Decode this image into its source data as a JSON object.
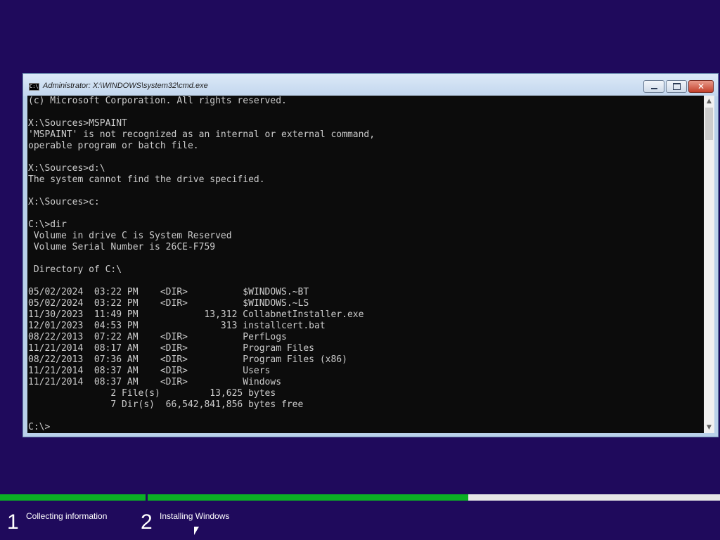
{
  "window": {
    "title": "Administrator: X:\\WINDOWS\\system32\\cmd.exe",
    "icon": "cmd-icon",
    "icon_text": "C:\\"
  },
  "console": {
    "lines": [
      "(c) Microsoft Corporation. All rights reserved.",
      "",
      "X:\\Sources>MSPAINT",
      "'MSPAINT' is not recognized as an internal or external command,",
      "operable program or batch file.",
      "",
      "X:\\Sources>d:\\",
      "The system cannot find the drive specified.",
      "",
      "X:\\Sources>c:",
      "",
      "C:\\>dir",
      " Volume in drive C is System Reserved",
      " Volume Serial Number is 26CE-F759",
      "",
      " Directory of C:\\",
      "",
      "05/02/2024  03:22 PM    <DIR>          $WINDOWS.~BT",
      "05/02/2024  03:22 PM    <DIR>          $WINDOWS.~LS",
      "11/30/2023  11:49 PM            13,312 CollabnetInstaller.exe",
      "12/01/2023  04:53 PM               313 installcert.bat",
      "08/22/2013  07:22 AM    <DIR>          PerfLogs",
      "11/21/2014  08:17 AM    <DIR>          Program Files",
      "08/22/2013  07:36 AM    <DIR>          Program Files (x86)",
      "11/21/2014  08:37 AM    <DIR>          Users",
      "11/21/2014  08:37 AM    <DIR>          Windows",
      "               2 File(s)         13,625 bytes",
      "               7 Dir(s)  66,542,841,856 bytes free",
      "",
      "C:\\>"
    ]
  },
  "setup": {
    "steps": [
      {
        "number": "1",
        "label": "Collecting information",
        "progress": 1.0
      },
      {
        "number": "2",
        "label": "Installing Windows",
        "progress": 0.56
      }
    ],
    "accent_color": "#0bb024",
    "background_color": "#1f0a5c"
  }
}
